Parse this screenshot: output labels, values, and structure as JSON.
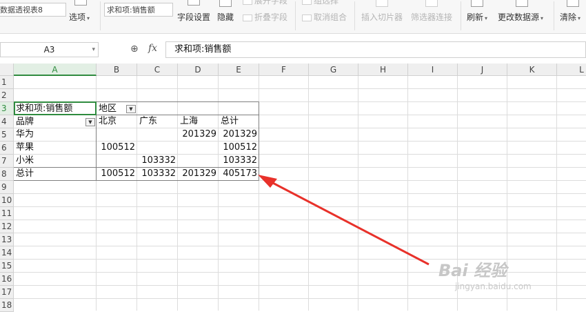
{
  "ribbon": {
    "pivot_name": "数据透视表8",
    "options_label": "选项",
    "active_field": "求和项:销售额",
    "field_settings_label": "字段设置",
    "hide_label": "隐藏",
    "expand_field_label": "展开字段",
    "collapse_field_label": "折叠字段",
    "group_label": "组选择",
    "ungroup_label": "取消组合",
    "insert_slicer_label": "插入切片器",
    "filter_connections_label": "筛选器连接",
    "refresh_label": "刷新",
    "change_source_label": "更改数据源",
    "clear_label": "清除"
  },
  "formula_bar": {
    "cell_ref": "A3",
    "fx_label": "fx",
    "formula": "求和项:销售额"
  },
  "columns": [
    "A",
    "B",
    "C",
    "D",
    "E",
    "F",
    "G",
    "H",
    "I",
    "J",
    "K",
    "L"
  ],
  "rows": [
    "1",
    "2",
    "3",
    "4",
    "5",
    "6",
    "7",
    "8",
    "9",
    "10",
    "11",
    "12",
    "13",
    "14",
    "15",
    "16",
    "17",
    "18"
  ],
  "pivot": {
    "value_field": "求和项:销售额",
    "column_field": "地区",
    "row_field": "品牌",
    "column_headers": [
      "北京",
      "广东",
      "上海",
      "总计"
    ],
    "body": [
      {
        "label": "华为",
        "values": [
          "",
          "",
          "201329",
          "201329"
        ]
      },
      {
        "label": "苹果",
        "values": [
          "100512",
          "",
          "",
          "100512"
        ]
      },
      {
        "label": "小米",
        "values": [
          "",
          "103332",
          "",
          "103332"
        ]
      },
      {
        "label": "总计",
        "values": [
          "100512",
          "103332",
          "201329",
          "405173"
        ]
      }
    ]
  },
  "annotation": {
    "arrow_color": "#e8312a"
  },
  "watermark": {
    "text": "Bai 经验",
    "sub": "jingyan.baidu.com"
  },
  "colors": {
    "selection": "#2e8b3e",
    "grid": "#d9d9d9",
    "header_bg": "#efefef"
  }
}
